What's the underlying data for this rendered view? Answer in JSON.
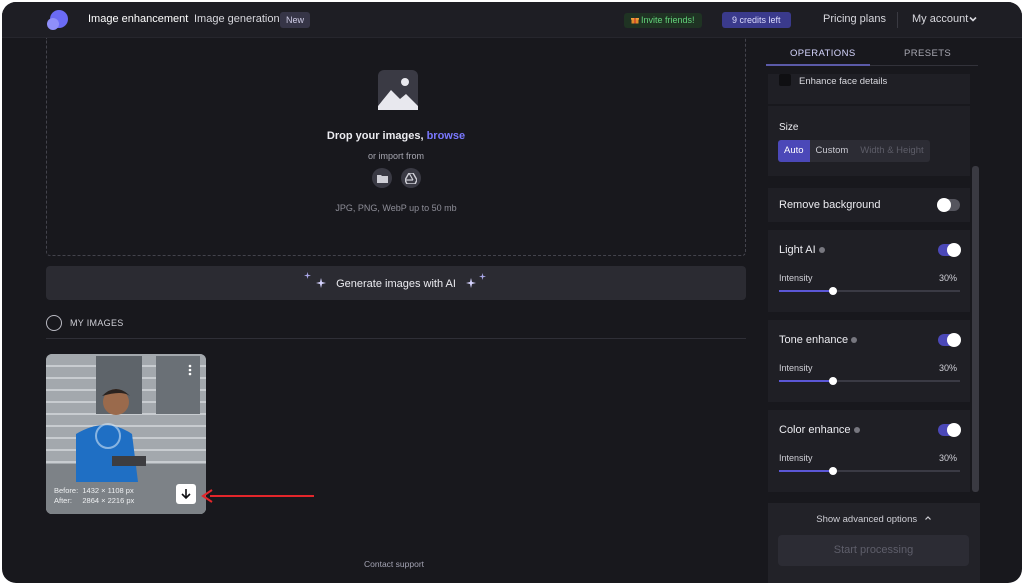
{
  "nav": {
    "enhancement": "Image enhancement",
    "generation": "Image generation",
    "new_badge": "New",
    "invite": "Invite friends!",
    "credits": "9 credits left",
    "pricing": "Pricing plans",
    "account": "My account"
  },
  "dropzone": {
    "title": "Drop your images, ",
    "browse": "browse",
    "import": "or import from",
    "formats": "JPG, PNG, WebP up to 50 mb"
  },
  "generate": {
    "label": "Generate images with AI"
  },
  "my_images": {
    "label": "MY IMAGES",
    "thumb": {
      "before_label": "Before:",
      "before_value": "1432 × 1108 px",
      "after_label": "After:",
      "after_value": "2864 × 2216 px"
    }
  },
  "footer": {
    "contact": "Contact support"
  },
  "panel": {
    "tabs": [
      "OPERATIONS",
      "PRESETS"
    ],
    "face_details": "Enhance face details",
    "size": {
      "label": "Size",
      "options": [
        "Auto",
        "Custom"
      ],
      "placeholder": "Width & Height"
    },
    "remove_bg": {
      "label": "Remove background",
      "enabled": false
    },
    "light_ai": {
      "label": "Light AI",
      "intensity_label": "Intensity",
      "value": "30%",
      "fraction": 0.3,
      "enabled": true
    },
    "tone": {
      "label": "Tone enhance",
      "intensity_label": "Intensity",
      "value": "30%",
      "fraction": 0.3,
      "enabled": true
    },
    "color": {
      "label": "Color enhance",
      "intensity_label": "Intensity",
      "value": "30%",
      "fraction": 0.3,
      "enabled": true
    },
    "advanced": "Show advanced options",
    "start": "Start processing"
  },
  "colors": {
    "accent": "#5b57d6",
    "toggle_on": "#4b48b8",
    "toggle_off": "#55555e",
    "annotation_arrow": "#e3262b"
  }
}
